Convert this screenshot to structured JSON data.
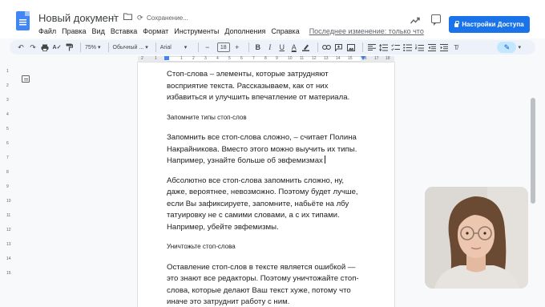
{
  "header": {
    "title": "Новый документ",
    "saving": "Сохранение...",
    "share_label": "Настройки Доступа",
    "icons": [
      "star-icon",
      "folder-move-icon",
      "cloud-sync-icon",
      "trend-icon",
      "comment-icon",
      "lock-icon"
    ]
  },
  "menu": {
    "items": [
      "Файл",
      "Правка",
      "Вид",
      "Вставка",
      "Формат",
      "Инструменты",
      "Дополнения",
      "Справка"
    ],
    "last_edit": "Последнее изменение: только что"
  },
  "toolbar": {
    "zoom": "75%",
    "style": "Обычный ...",
    "font": "Arial",
    "font_size": "18",
    "minus": "−",
    "plus": "+",
    "bold": "B",
    "italic": "I",
    "underline": "U",
    "text_color": "A"
  },
  "ruler": {
    "numbers": [
      "2",
      "1",
      "1",
      "2",
      "3",
      "4",
      "5",
      "6",
      "7",
      "8",
      "9",
      "10",
      "11",
      "12",
      "13",
      "14",
      "15",
      "16",
      "17",
      "18"
    ],
    "vertical_numbers": [
      "1",
      "2",
      "3",
      "4",
      "5",
      "6",
      "7",
      "8",
      "9",
      "10",
      "11",
      "12",
      "13",
      "14",
      "15"
    ]
  },
  "document": {
    "p1": "Стоп-слова – элементы, которые затрудняют восприятие текста. Рассказываем, как от них избавиться и улучшить впечатление от материала.",
    "h1": "Запомните типы стоп-слов",
    "p2": "Запомнить все стоп-слова сложно, – считает Полина Накрайникова. Вместо этого можно выучить их типы. Например, узнайте больше об эвфемизмах",
    "p3": "Абсолютно все стоп-слова запомнить сложно, ну, даже, вероятнее, невозможно. Поэтому будет лучше, если Вы зафиксируете, запомните, набьёте на лбу татуировку не с самими словами, а с их типами. Например, убейте эвфемизмы.",
    "h2": "Уничтожьте стоп-слова",
    "p4": "Оставление стоп-слов в тексте является ошибкой — это знают все редакторы. Поэтому уничтожайте стоп-слова, которые делают Ваш текст хуже, потому что иначе это затруднит работу с ним."
  },
  "colors": {
    "accent": "#1a73e8",
    "toolbar_bg": "#edf2fa",
    "doc_icon": "#4285f4"
  }
}
